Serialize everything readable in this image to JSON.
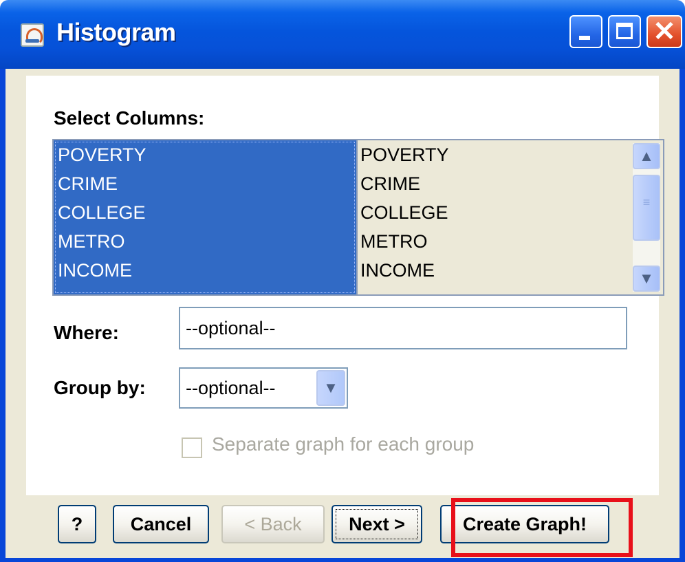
{
  "window": {
    "title": "Histogram",
    "controls": [
      "minimize",
      "maximize",
      "close"
    ],
    "close_glyph": "✕"
  },
  "select_columns": {
    "label": "Select Columns:",
    "available": [
      "POVERTY",
      "CRIME",
      "COLLEGE",
      "METRO",
      "INCOME"
    ],
    "selected_list": [
      "POVERTY",
      "CRIME",
      "COLLEGE",
      "METRO",
      "INCOME"
    ]
  },
  "where": {
    "label": "Where:",
    "value": "--optional--"
  },
  "group_by": {
    "label": "Group by:",
    "selected": "--optional--"
  },
  "separate_graph": {
    "label": "Separate graph for each group",
    "checked": false,
    "enabled": false
  },
  "buttons": {
    "help": "?",
    "cancel": "Cancel",
    "back": "< Back",
    "next": "Next >",
    "create": "Create Graph!"
  },
  "icons": {
    "app": "java-cup-icon",
    "scroll_up": "▲",
    "scroll_down": "▼",
    "thumb_grip": "≡",
    "combo_arrow": "▼"
  },
  "colors": {
    "titlebar": "#0555dc",
    "selection": "#316ac5",
    "highlight_box": "#e8101a",
    "dialog_bg": "#ece9d8"
  }
}
